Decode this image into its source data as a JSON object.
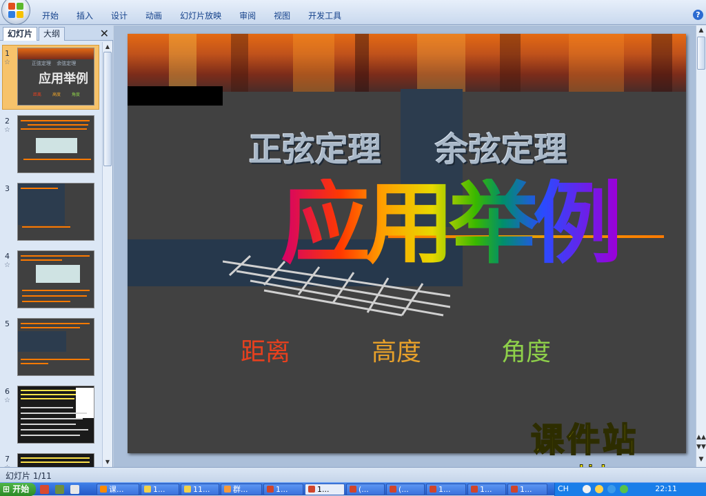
{
  "ribbon": {
    "tabs": [
      "开始",
      "插入",
      "设计",
      "动画",
      "幻灯片放映",
      "审阅",
      "视图",
      "开发工具"
    ],
    "help_label": "?"
  },
  "left_panel": {
    "tabs": [
      "幻灯片",
      "大纲"
    ],
    "close_label": "✕",
    "thumbnails": [
      {
        "number": "1",
        "has_animation": true,
        "selected": true
      },
      {
        "number": "2",
        "has_animation": true,
        "selected": false
      },
      {
        "number": "3",
        "has_animation": false,
        "selected": false
      },
      {
        "number": "4",
        "has_animation": true,
        "selected": false
      },
      {
        "number": "5",
        "has_animation": false,
        "selected": false
      },
      {
        "number": "6",
        "has_animation": true,
        "selected": false
      },
      {
        "number": "7",
        "has_animation": true,
        "selected": false
      }
    ]
  },
  "slide": {
    "subtitle_left": "正弦定理",
    "subtitle_right": "余弦定理",
    "main_title": "应用举例",
    "keywords": [
      {
        "text": "距离",
        "color": "#e8401e"
      },
      {
        "text": "高度",
        "color": "#e8a12a"
      },
      {
        "text": "角度",
        "color": "#8ed04a"
      }
    ],
    "thumb1_subtitles": [
      "正弦定理",
      "余弦定理"
    ],
    "thumb1_title": "应用举例",
    "thumb1_keywords": [
      "距离",
      "高度",
      "角度"
    ]
  },
  "watermark": {
    "chinese": "课件站",
    "url": "www.kjzhan.com"
  },
  "status_bar": {
    "slide_counter": "幻灯片 1/11"
  },
  "taskbar": {
    "start_label": "开始",
    "tasks": [
      "课...",
      "1...",
      "11...",
      "群...",
      "1...",
      "1...",
      "(...",
      "(...",
      "1...",
      "1...",
      "1..."
    ],
    "ime_label": "CH",
    "clock": "22:11"
  },
  "colors": {
    "ribbon_text": "#15428b",
    "selected_thumb": "#f7c36b",
    "slide_bg": "#414141",
    "watermark": "#f5e600"
  }
}
